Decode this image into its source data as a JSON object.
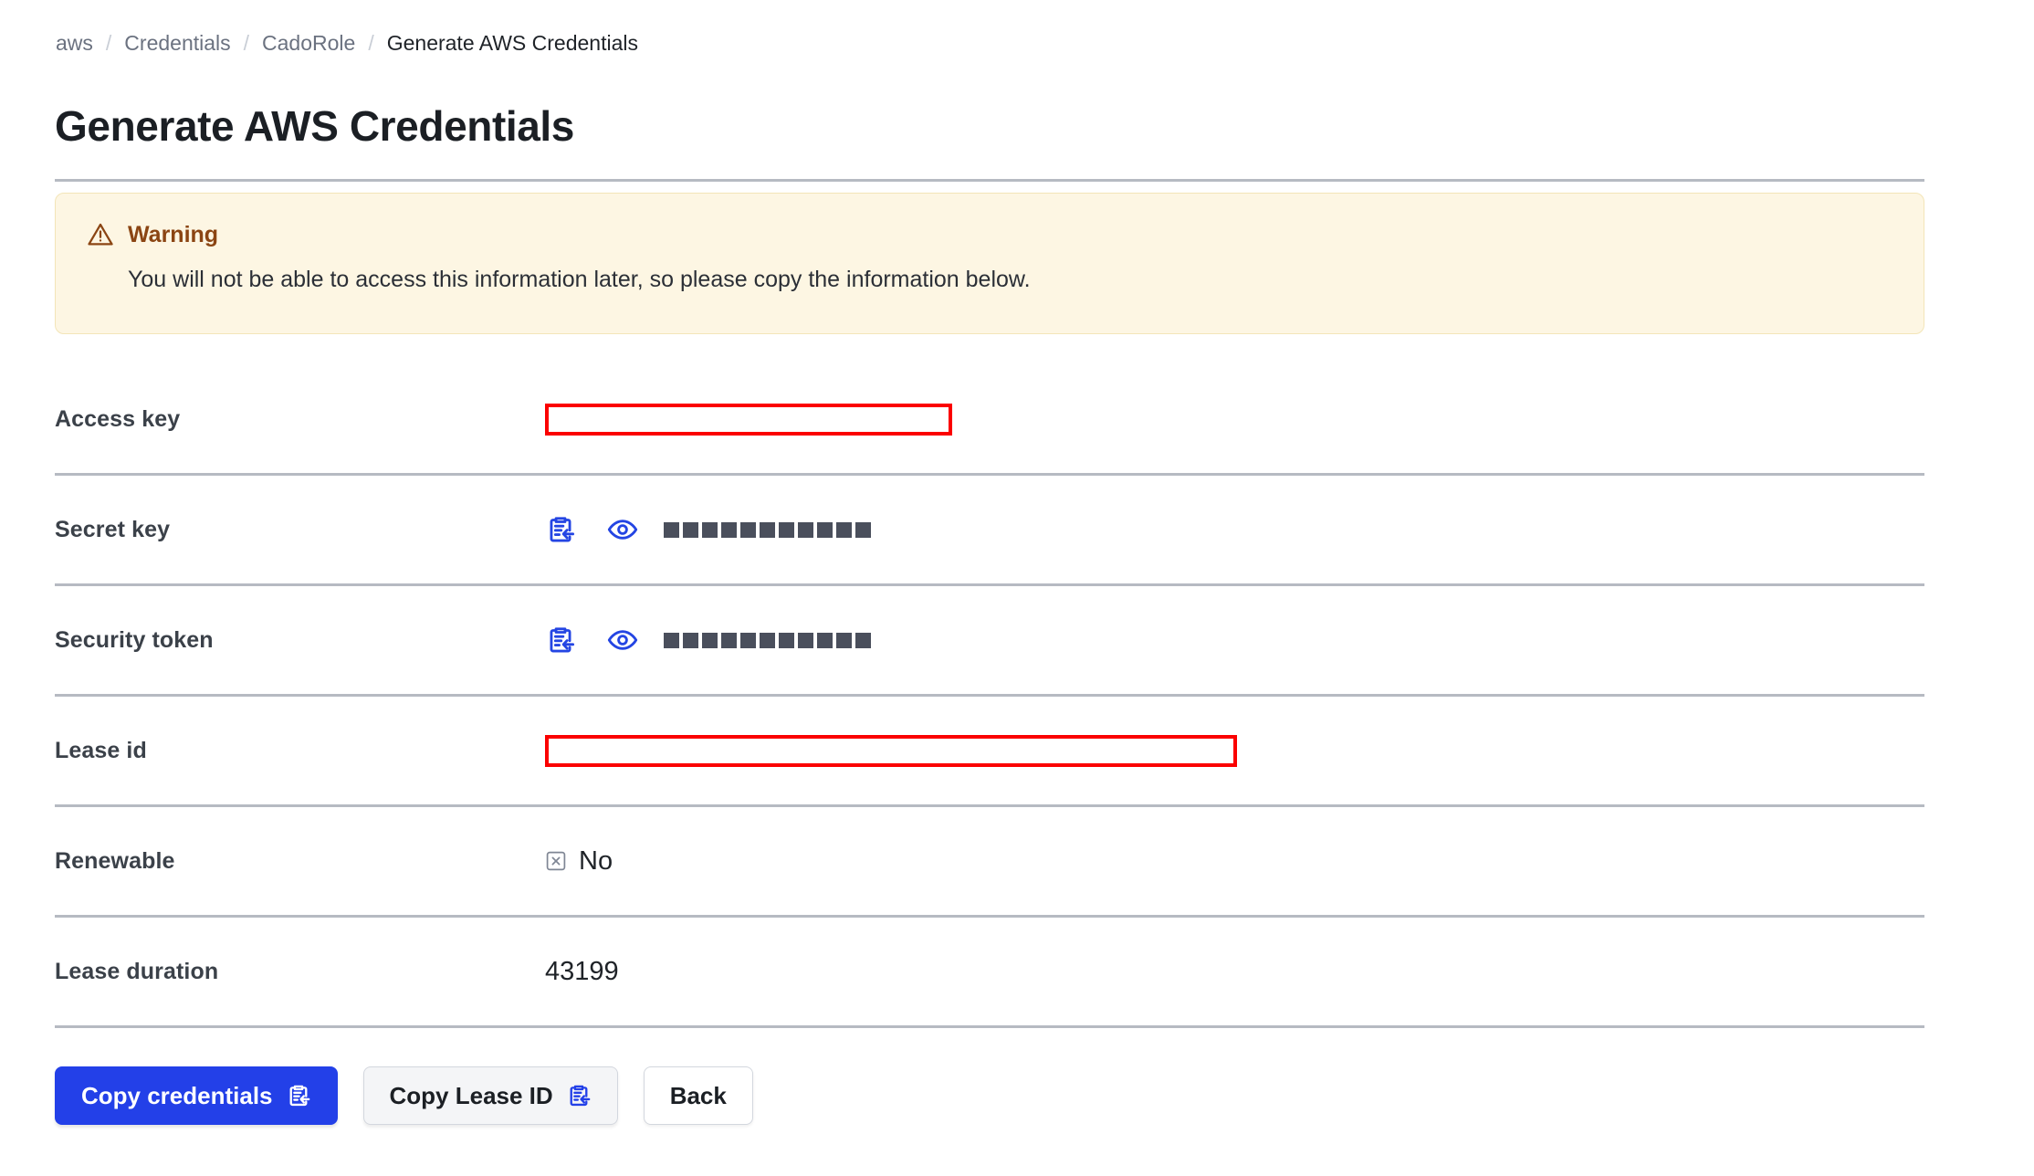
{
  "breadcrumb": {
    "items": [
      {
        "label": "aws",
        "current": false
      },
      {
        "label": "Credentials",
        "current": false
      },
      {
        "label": "CadoRole",
        "current": false
      },
      {
        "label": "Generate AWS Credentials",
        "current": true
      }
    ],
    "separator": "/"
  },
  "page": {
    "title": "Generate AWS Credentials"
  },
  "alert": {
    "icon": "warning-triangle-icon",
    "title": "Warning",
    "message": "You will not be able to access this information later, so please copy the information below.",
    "background_color": "#fdf6e3",
    "title_color": "#8b4513"
  },
  "rows": [
    {
      "label": "Access key",
      "value_type": "redacted",
      "value": ""
    },
    {
      "label": "Secret key",
      "value_type": "masked",
      "masked_length": 11,
      "copy_icon": "clipboard-copy-icon",
      "reveal_icon": "eye-icon"
    },
    {
      "label": "Security token",
      "value_type": "masked",
      "masked_length": 11,
      "copy_icon": "clipboard-copy-icon",
      "reveal_icon": "eye-icon"
    },
    {
      "label": "Lease id",
      "value_type": "redacted",
      "value": ""
    },
    {
      "label": "Renewable",
      "value_type": "boolean",
      "value": "No",
      "icon": "x-in-box-icon"
    },
    {
      "label": "Lease duration",
      "value_type": "text",
      "value": "43199"
    }
  ],
  "buttons": {
    "copy_credentials": "Copy credentials",
    "copy_lease_id": "Copy Lease ID",
    "back": "Back"
  },
  "colors": {
    "accent": "#2340e8",
    "redaction_border": "#fb0000",
    "divider": "#b6bac2",
    "label": "#3b4149"
  }
}
